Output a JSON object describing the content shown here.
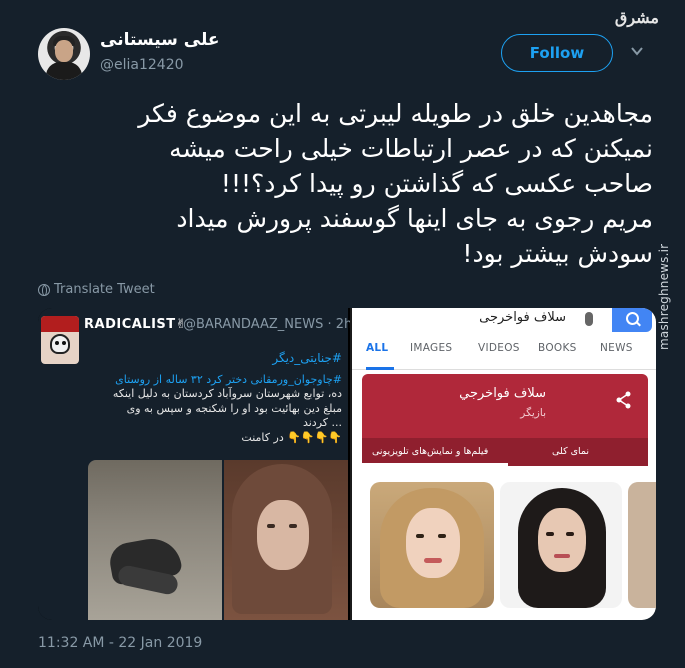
{
  "watermark": {
    "logo_text": "مشرق",
    "url_text": "mashreghnews.ir"
  },
  "author": {
    "display_name": "علی سیستانی",
    "handle": "@elia12420"
  },
  "follow_button": {
    "label": "Follow",
    "color": "#1da1f2"
  },
  "tweet": {
    "lines": [
      "مجاهدین خلق در طویله لیبرتی به این موضوع فکر",
      "نمیکنن که در عصر ارتباطات خیلی راحت میشه",
      "صاحب عکسی که گذاشتن رو پیدا کرد؟!!!",
      "مریم رجوی به جای اینها گوسفند پرورش میداد",
      "سودش بیشتر بود!"
    ]
  },
  "translate_label": "Translate Tweet",
  "embedded_tweet": {
    "name": "RADICALIST✌",
    "handle_time": "@BARANDAAZ_NEWS · 2h",
    "hashtag": "#جنایتی_دیگر",
    "body_lines": [
      "#چاوجوان_ورمقانی دختر کرد ۳۲ ساله از روستای",
      "ده، توابع شهرستان سروآباد کردستان به دلیل اینکه",
      "مبلغ دین بهائیت بود او را شکنجه و سپس به وی",
      "... کردند",
      "👇👇👇👇 در کامنت"
    ]
  },
  "google_result": {
    "query": "سلاف فواخرجی",
    "tabs": [
      "ALL",
      "IMAGES",
      "VIDEOS",
      "BOOKS",
      "NEWS"
    ],
    "panel_name": "سلاف فواخرجي",
    "panel_subtitle": "بازیگر",
    "panel_tabs": [
      "فیلم‌ها و نمایش‌های تلویزیونی",
      "نمای کلی"
    ],
    "panel_color": "#b0283a"
  },
  "timestamp": "11:32 AM - 22 Jan 2019"
}
